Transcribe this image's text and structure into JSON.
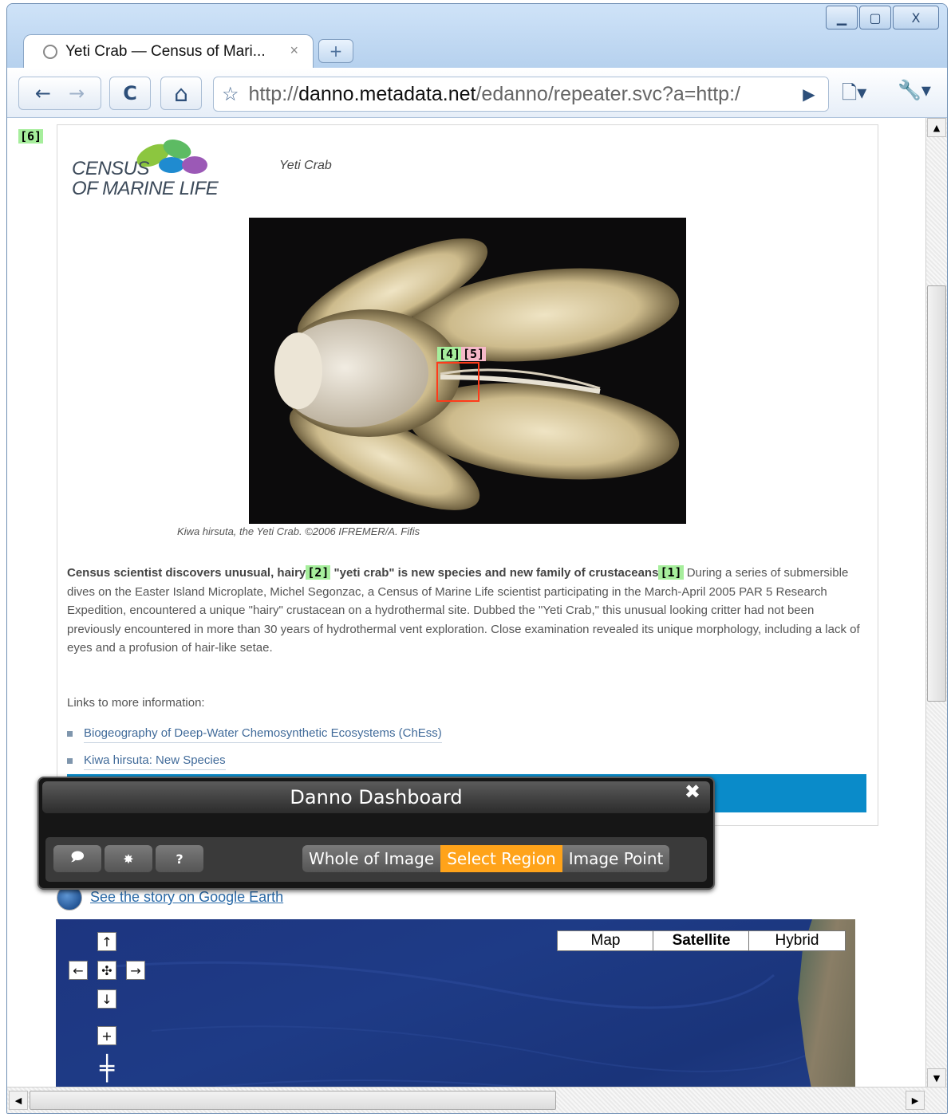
{
  "window": {
    "minimize_glyph": "▁",
    "maximize_glyph": "▢",
    "close_glyph": "X"
  },
  "tab": {
    "title": "Yeti Crab — Census of Mari...",
    "close_glyph": "×",
    "new_tab_glyph": "+"
  },
  "toolbar": {
    "back_glyph": "←",
    "forward_glyph": "→",
    "reload_glyph": "C",
    "home_glyph": "⌂",
    "star_glyph": "☆",
    "url_scheme": "http://",
    "url_domain": "danno.metadata.net",
    "url_path": "/edanno/repeater.svc?a=http:/",
    "go_glyph": "▶",
    "page_menu_glyph": "🗋▾",
    "wrench_glyph": "🔧▾"
  },
  "page": {
    "marker_6": "[6]",
    "logo_line1": "CENSUS",
    "logo_line2": "OF MARINE LIFE",
    "subtitle": "Yeti Crab",
    "marker_4": "[4]",
    "marker_5": "[5]",
    "caption": "Kiwa hirsuta, the Yeti Crab.   ©2006 IFREMER/A. Fifis",
    "headline_part1": "Census scientist discovers unusual, hairy",
    "marker_2": "[2]",
    "headline_part2": " \"yeti crab\" is new species and new family of crustaceans",
    "marker_1": "[1]",
    "body": "   During a series of submersible dives on the Easter Island Microplate, Michel Segonzac, a Census of Marine Life scientist participating in the March-April 2005 PAR 5 Research Expedition, encountered a unique \"hairy\" crustacean on a hydrothermal site. Dubbed the \"Yeti Crab,\" this unusual looking critter had not been previously encountered in more than 30 years of hydrothermal vent exploration. Close examination revealed its unique morphology, including a lack of eyes and a profusion of hair-like setae.",
    "links_heading": "Links to more information:",
    "link1": "Biogeography of Deep-Water Chemosynthetic Ecosystems (ChEss)",
    "link2": "Kiwa hirsuta: New Species",
    "google_earth_link": "See the story on Google Earth"
  },
  "dashboard": {
    "title": "Danno Dashboard",
    "close_glyph": "✖",
    "btn_comment_glyph": "🗩",
    "btn_settings_glyph": "✸",
    "btn_help_glyph": "?",
    "modes": [
      "Whole of Image",
      "Select Region",
      "Image Point"
    ],
    "active_mode": "Select Region",
    "active_color": "#ffa31a"
  },
  "map": {
    "types": [
      "Map",
      "Satellite",
      "Hybrid"
    ],
    "selected_type": "Satellite",
    "pan_up": "↑",
    "pan_left": "←",
    "pan_center": "✣",
    "pan_right": "→",
    "pan_down": "↓",
    "zoom_in": "+",
    "zoom_slider": "╪"
  },
  "scrollbars": {
    "up": "▲",
    "down": "▼",
    "left": "◀",
    "right": "▶"
  }
}
